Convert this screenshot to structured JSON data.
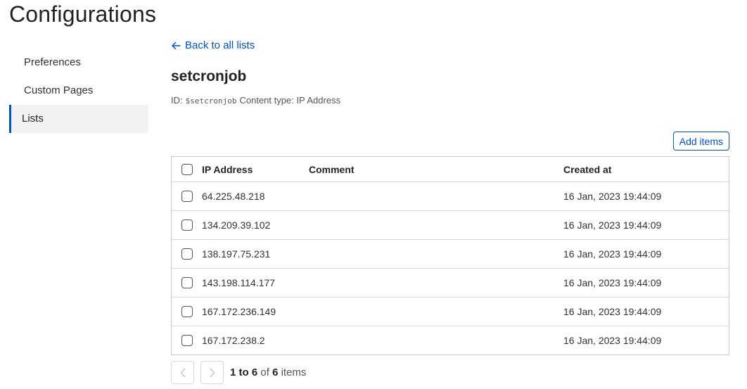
{
  "page": {
    "title": "Configurations"
  },
  "sidebar": {
    "items": [
      {
        "label": "Preferences",
        "active": false
      },
      {
        "label": "Custom Pages",
        "active": false
      },
      {
        "label": "Lists",
        "active": true
      }
    ]
  },
  "main": {
    "back_link": "Back to all lists",
    "list_name": "setcronjob",
    "id_label": "ID:",
    "id_value": "$setcronjob",
    "content_type_label": "Content type:",
    "content_type_value": "IP Address",
    "add_items_label": "Add items"
  },
  "table": {
    "columns": {
      "ip": "IP Address",
      "comment": "Comment",
      "created": "Created at"
    },
    "rows": [
      {
        "ip": "64.225.48.218",
        "comment": "",
        "created": "16 Jan, 2023 19:44:09"
      },
      {
        "ip": "134.209.39.102",
        "comment": "",
        "created": "16 Jan, 2023 19:44:09"
      },
      {
        "ip": "138.197.75.231",
        "comment": "",
        "created": "16 Jan, 2023 19:44:09"
      },
      {
        "ip": "143.198.114.177",
        "comment": "",
        "created": "16 Jan, 2023 19:44:09"
      },
      {
        "ip": "167.172.236.149",
        "comment": "",
        "created": "16 Jan, 2023 19:44:09"
      },
      {
        "ip": "167.172.238.2",
        "comment": "",
        "created": "16 Jan, 2023 19:44:09"
      }
    ]
  },
  "pagination": {
    "from": "1",
    "to_word": "to",
    "to": "6",
    "of_word": "of",
    "total": "6",
    "items_word": "items"
  },
  "colors": {
    "accent": "#0051c3",
    "active_bg": "#f2f2f2"
  },
  "icons": {
    "back": "arrow-left-icon",
    "prev": "chevron-left-icon",
    "next": "chevron-right-icon"
  }
}
